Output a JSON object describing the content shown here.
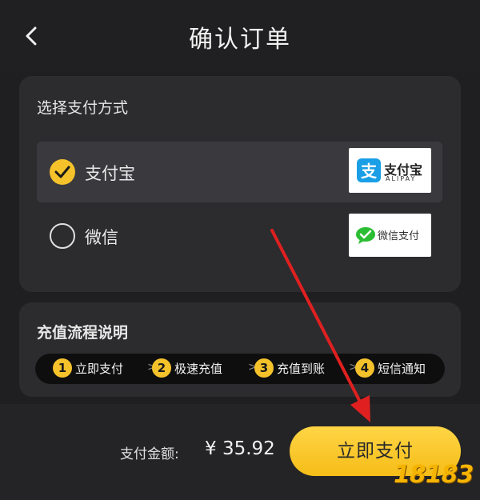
{
  "header": {
    "title": "确认订单",
    "back_icon": "chevron-left-icon"
  },
  "payment": {
    "title": "选择支付方式",
    "options": [
      {
        "label": "支付宝",
        "selected": true,
        "logo_cn": "支付宝",
        "logo_en": "ALIPAY",
        "logo_color": "#1a9fe6"
      },
      {
        "label": "微信",
        "selected": false,
        "logo_cn": "微信支付",
        "logo_color": "#2bbd33"
      }
    ]
  },
  "flow": {
    "title": "充值流程说明",
    "steps": [
      {
        "num": "1",
        "label": "立即支付"
      },
      {
        "num": "2",
        "label": "极速充值"
      },
      {
        "num": "3",
        "label": "充值到账"
      },
      {
        "num": "4",
        "label": "短信通知"
      }
    ],
    "separator": ">>"
  },
  "footer": {
    "amount_label": "支付金额:",
    "amount_value": "¥ 35.92",
    "pay_button": "立即支付"
  },
  "watermark": {
    "text": "18183"
  },
  "colors": {
    "accent": "#f5c22b",
    "annotation": "#e02020",
    "background": "#1f1f21"
  }
}
